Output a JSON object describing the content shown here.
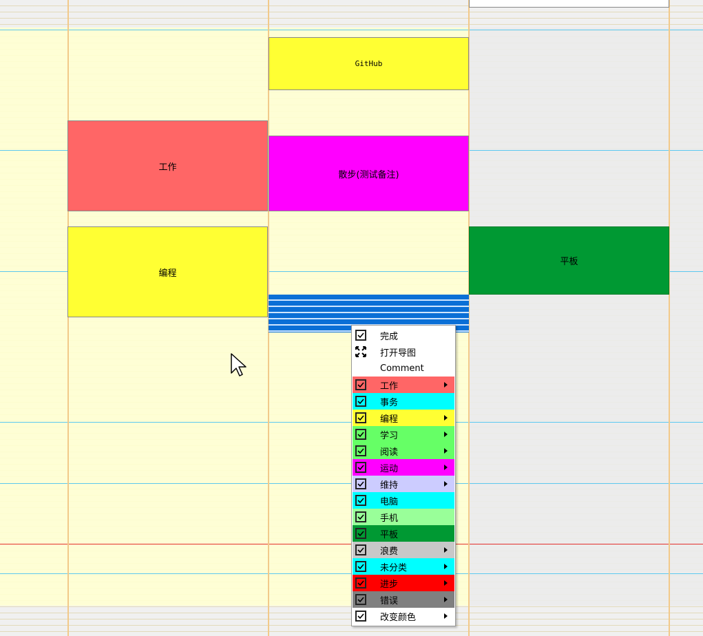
{
  "calendar": {
    "events": {
      "github": "GitHub",
      "work": "工作",
      "walk": "散步(测试备注)",
      "coding": "编程",
      "tablet": "平板"
    },
    "colors": {
      "github": "#ffff33",
      "work": "#ff6666",
      "walk": "#ff00ff",
      "coding": "#ffff33",
      "tablet": "#009933",
      "selection": "#0a6fd6"
    }
  },
  "context_menu": {
    "items": [
      {
        "label": "完成",
        "icon": "check-icon"
      },
      {
        "label": "打开导图",
        "icon": "expand-icon"
      },
      {
        "label": "Comment",
        "icon": ""
      }
    ],
    "categories": [
      {
        "label": "工作",
        "color": "#ff6666",
        "submenu": true
      },
      {
        "label": "事务",
        "color": "#00ffff",
        "submenu": false
      },
      {
        "label": "编程",
        "color": "#ffff33",
        "submenu": true
      },
      {
        "label": "学习",
        "color": "#66ff66",
        "submenu": true
      },
      {
        "label": "阅读",
        "color": "#66ff66",
        "submenu": true
      },
      {
        "label": "运动",
        "color": "#ff00ff",
        "submenu": true
      },
      {
        "label": "维持",
        "color": "#ccccff",
        "submenu": true
      },
      {
        "label": "电脑",
        "color": "#00ffff",
        "submenu": false
      },
      {
        "label": "手机",
        "color": "#99ff99",
        "submenu": false
      },
      {
        "label": "平板",
        "color": "#009933",
        "submenu": false
      },
      {
        "label": "浪费",
        "color": "#c8c8c8",
        "submenu": true
      },
      {
        "label": "未分类",
        "color": "#00ffff",
        "submenu": true
      },
      {
        "label": "进步",
        "color": "#ff0000",
        "submenu": true
      },
      {
        "label": "错误",
        "color": "#808080",
        "submenu": true
      }
    ],
    "last": {
      "label": "改变颜色",
      "submenu": true
    }
  }
}
